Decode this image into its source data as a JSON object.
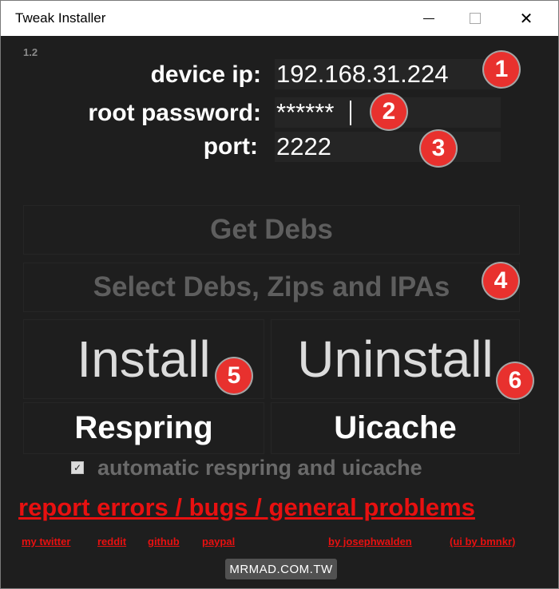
{
  "window": {
    "title": "Tweak Installer",
    "minimize_glyph": "—",
    "close_glyph": "✕"
  },
  "version": "1.2",
  "form": {
    "ip_label": "device ip:",
    "ip_value": "192.168.31.224",
    "password_label": "root password:",
    "password_value": "******",
    "port_label": "port:",
    "port_value": "2222"
  },
  "buttons": {
    "get_debs": "Get Debs",
    "select_debs": "Select Debs, Zips and IPAs",
    "install": "Install",
    "uninstall": "Uninstall",
    "respring": "Respring",
    "uicache": "Uicache"
  },
  "checkbox": {
    "label": "automatic respring and uicache",
    "checked": true,
    "glyph": "✓"
  },
  "links": {
    "report": "report errors / bugs / general problems",
    "my_twitter": "my twitter",
    "reddit": "reddit",
    "github": "github",
    "paypal": "paypal",
    "by_author": "by josephwalden",
    "ui_by": "(ui by bmnkr)"
  },
  "markers": [
    "1",
    "2",
    "3",
    "4",
    "5",
    "6"
  ],
  "watermark": "MRMAD.COM.TW",
  "colors": {
    "background": "#1e1e1e",
    "marker": "#e8312e",
    "link": "#e81010",
    "disabled_text": "#5e5e5e"
  }
}
